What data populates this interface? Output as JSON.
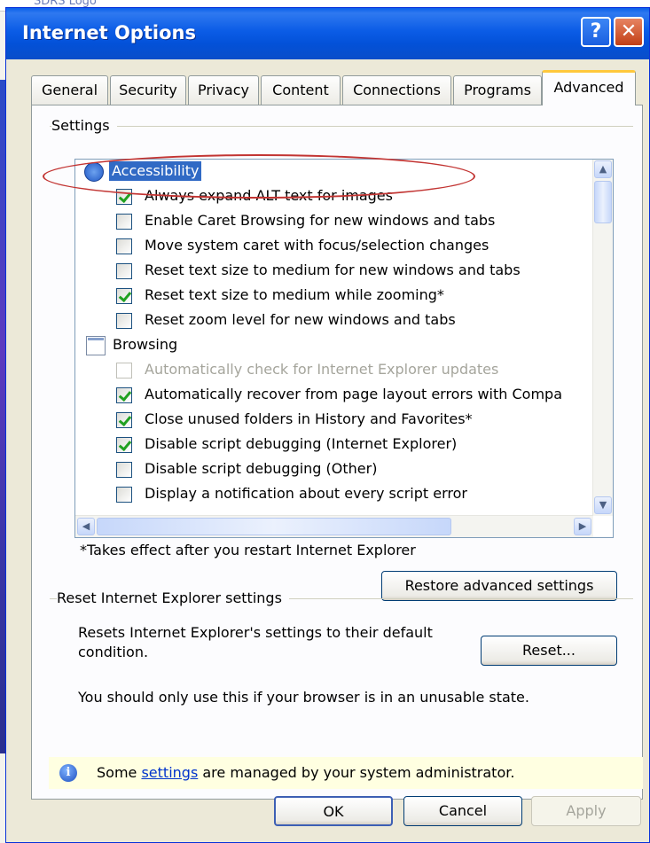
{
  "window": {
    "title": "Internet Options",
    "help_label": "?",
    "close_label": "✕"
  },
  "background": {
    "logo_fragment": "SDRS Logo"
  },
  "tabs": [
    {
      "label": "General"
    },
    {
      "label": "Security"
    },
    {
      "label": "Privacy"
    },
    {
      "label": "Content"
    },
    {
      "label": "Connections"
    },
    {
      "label": "Programs"
    },
    {
      "label": "Advanced",
      "active": true
    }
  ],
  "settings": {
    "group_label": "Settings",
    "categories": [
      {
        "label": "Accessibility",
        "icon": "accessibility-icon",
        "items": [
          {
            "label": "Always expand ALT text for images",
            "checked": true,
            "disabled": false
          },
          {
            "label": "Enable Caret Browsing for new windows and tabs",
            "checked": false,
            "disabled": false
          },
          {
            "label": "Move system caret with focus/selection changes",
            "checked": false,
            "disabled": false
          },
          {
            "label": "Reset text size to medium for new windows and tabs",
            "checked": false,
            "disabled": false
          },
          {
            "label": "Reset text size to medium while zooming*",
            "checked": true,
            "disabled": false
          },
          {
            "label": "Reset zoom level for new windows and tabs",
            "checked": false,
            "disabled": false
          }
        ]
      },
      {
        "label": "Browsing",
        "icon": "browsing-icon",
        "items": [
          {
            "label": "Automatically check for Internet Explorer updates",
            "checked": false,
            "disabled": true
          },
          {
            "label": "Automatically recover from page layout errors with Compa",
            "checked": true,
            "disabled": false
          },
          {
            "label": "Close unused folders in History and Favorites*",
            "checked": true,
            "disabled": false
          },
          {
            "label": "Disable script debugging (Internet Explorer)",
            "checked": true,
            "disabled": false
          },
          {
            "label": "Disable script debugging (Other)",
            "checked": false,
            "disabled": false
          },
          {
            "label": "Display a notification about every script error",
            "checked": false,
            "disabled": false
          }
        ]
      }
    ],
    "restart_note": "*Takes effect after you restart Internet Explorer",
    "restore_button": "Restore advanced settings"
  },
  "reset_section": {
    "group_label": "Reset Internet Explorer settings",
    "description": "Resets Internet Explorer's settings to their default condition.",
    "reset_button": "Reset...",
    "warning": "You should only use this if your browser is in an unusable state."
  },
  "info_bar": {
    "prefix": "Some ",
    "link": "settings",
    "suffix": " are managed by your system administrator."
  },
  "dialog_buttons": {
    "ok": "OK",
    "cancel": "Cancel",
    "apply": "Apply"
  }
}
